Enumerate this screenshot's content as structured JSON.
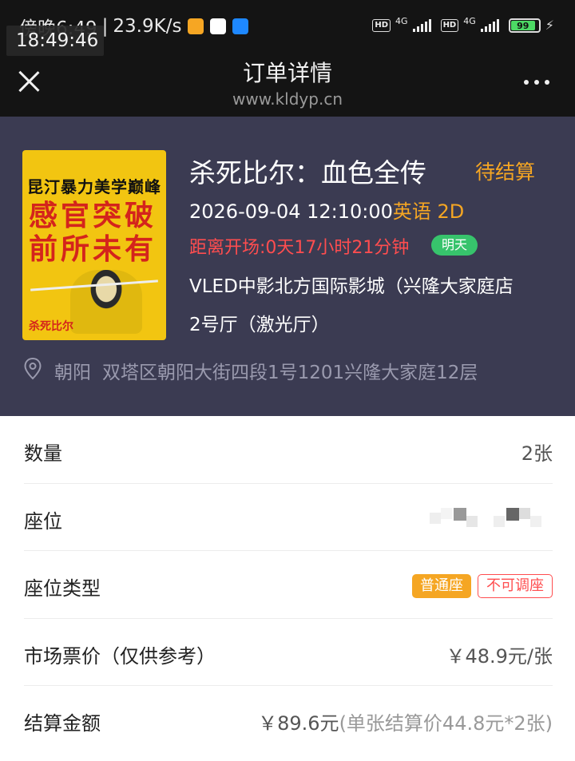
{
  "status_bar": {
    "time_text": "傍晚6:49",
    "speed": "23.9K/s",
    "clock_overlay": "18:49:46",
    "network_1": "4G",
    "network_2": "4G",
    "hd_label": "HD",
    "battery": "99"
  },
  "nav": {
    "title": "订单详情",
    "url": "www.kldyp.cn"
  },
  "movie": {
    "poster_tagline": "昆汀暴力美学巅峰",
    "poster_headline_1": "感官突破",
    "poster_headline_2": "前所未有",
    "poster_logo": "杀死比尔",
    "title": "杀死比尔：血色全传",
    "status": "待结算",
    "datetime": "2026-09-04 12:10:00",
    "language": "英语 2D",
    "countdown": "距离开场:0天17小时21分钟",
    "day_badge": "明天",
    "cinema": "VLED中影北方国际影城（兴隆大家庭店",
    "hall": "2号厅（激光厅）",
    "district": "朝阳",
    "address": "双塔区朝阳大街四段1号1201兴隆大家庭12层"
  },
  "details": {
    "quantity_label": "数量",
    "quantity_value": "2张",
    "seat_label": "座位",
    "seat_type_label": "座位类型",
    "seat_type_tag": "普通座",
    "seat_change_tag": "不可调座",
    "market_price_label": "市场票价（仅供参考）",
    "market_price_value": "￥48.9元/张",
    "settle_label": "结算金额",
    "settle_value": "￥89.6元",
    "settle_detail": "(单张结算价44.8元*2张)"
  },
  "colors": {
    "accent_orange": "#f5a623",
    "alert_red": "#ff4d4f",
    "badge_green": "#37c36c",
    "hero_bg": "#3b3b52"
  }
}
